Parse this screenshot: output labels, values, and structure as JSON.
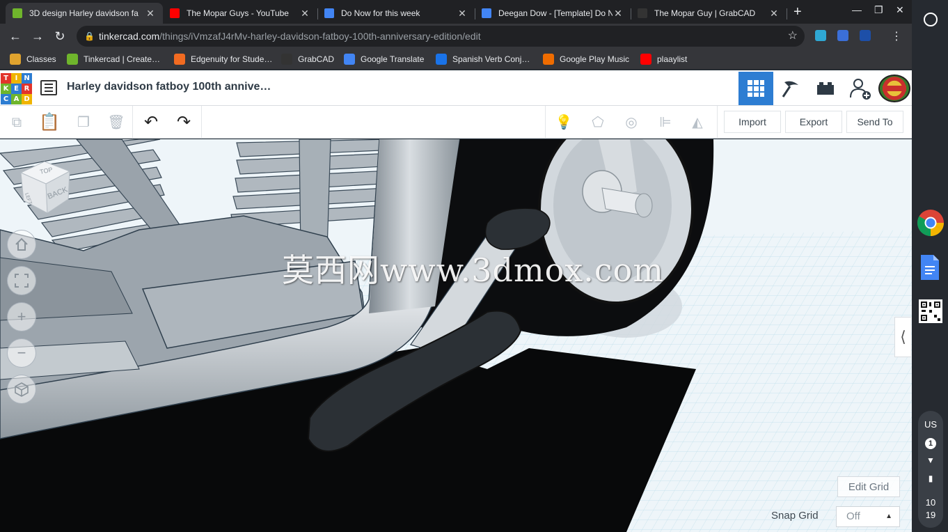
{
  "browser": {
    "tabs": [
      {
        "title": "3D design Harley davidson fa",
        "favicon_color": "#6fb52c",
        "active": true
      },
      {
        "title": "The Mopar Guys - YouTube",
        "favicon_color": "#ff0000",
        "active": false
      },
      {
        "title": "Do Now for this week",
        "favicon_color": "#4285f4",
        "active": false
      },
      {
        "title": "Deegan Dow - [Template] Do N",
        "favicon_color": "#4285f4",
        "active": false
      },
      {
        "title": "The Mopar Guy | GrabCAD",
        "favicon_color": "#333333",
        "active": false
      }
    ],
    "url_domain": "tinkercad.com",
    "url_path": "/things/iVmzafJ4rMv-harley-davidson-fatboy-100th-anniversary-edition/edit",
    "bookmarks": [
      {
        "label": "Classes",
        "icon_color": "#e0a32e"
      },
      {
        "label": "Tinkercad | Create…",
        "icon_color": "#6fb52c"
      },
      {
        "label": "Edgenuity for Stude…",
        "icon_color": "#f26b21"
      },
      {
        "label": "GrabCAD",
        "icon_color": "#333333"
      },
      {
        "label": "Google Translate",
        "icon_color": "#4285f4"
      },
      {
        "label": "Spanish Verb Conj…",
        "icon_color": "#1a73e8"
      },
      {
        "label": "Google Play Music",
        "icon_color": "#ef6c00"
      },
      {
        "label": "plaaylist",
        "icon_color": "#ff0000"
      }
    ]
  },
  "tinkercad": {
    "logo_letters": [
      "T",
      "I",
      "N",
      "K",
      "E",
      "R",
      "C",
      "A",
      "D"
    ],
    "design_title": "Harley davidson fatboy 100th annive…",
    "buttons": {
      "import": "Import",
      "export": "Export",
      "send_to": "Send To"
    },
    "navcube": {
      "top": "TOP",
      "back": "BACK",
      "side": "LEFT"
    },
    "watermark": "莫西网www.3dmox.com",
    "edit_grid": "Edit Grid",
    "snap_grid_label": "Snap Grid",
    "snap_grid_value": "Off"
  },
  "shelf": {
    "ime": "US",
    "notification_count": "1",
    "time_hour": "10",
    "time_minute": "19"
  },
  "colors": {
    "accent": "#2d7dd2",
    "model_gray": "#a9b2ba",
    "dark_part": "#2b3035",
    "grid": "#bfe3ef"
  }
}
